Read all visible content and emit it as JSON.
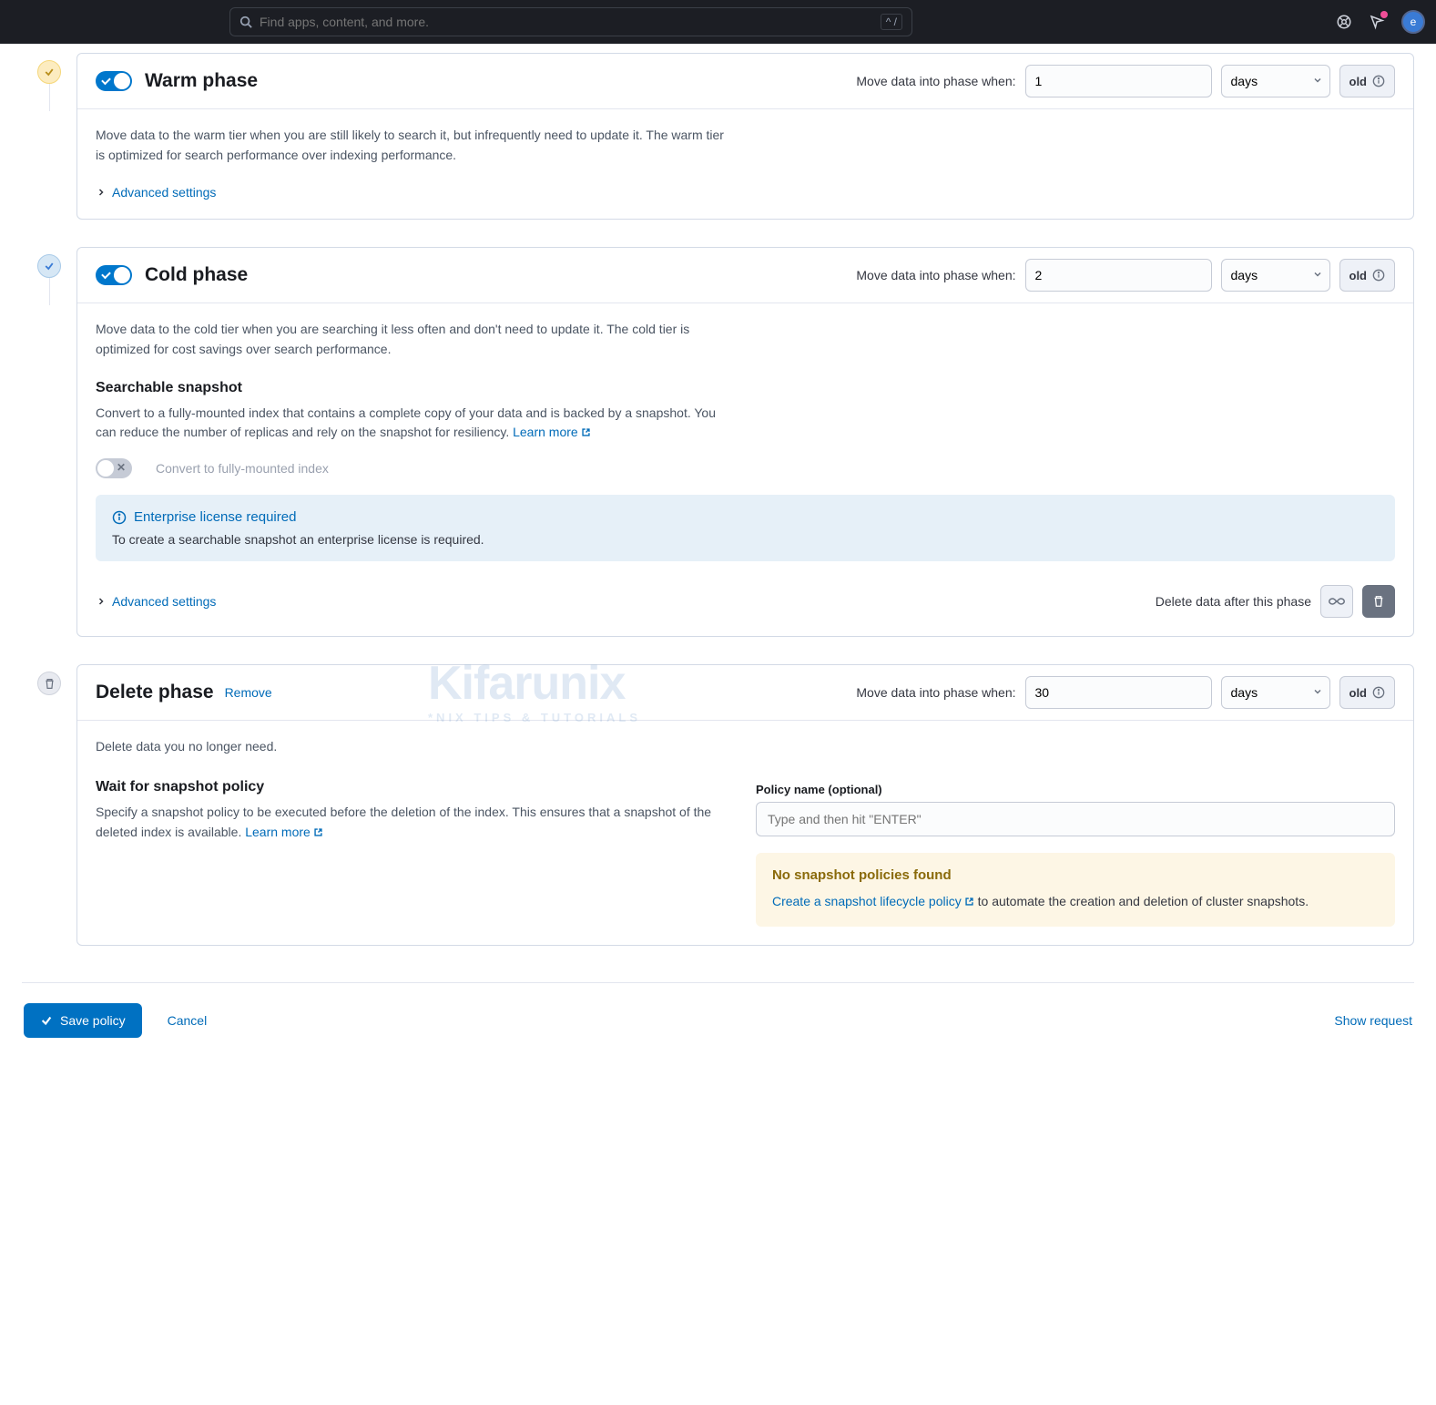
{
  "search": {
    "placeholder": "Find apps, content, and more.",
    "kbd": "^ /"
  },
  "avatar": "e",
  "common": {
    "moveLabel": "Move data into phase when:",
    "unitDays": "days",
    "old": "old",
    "advanced": "Advanced settings",
    "learnMore": "Learn more"
  },
  "warm": {
    "title": "Warm phase",
    "value": "1",
    "desc": "Move data to the warm tier when you are still likely to search it, but infrequently need to update it. The warm tier is optimized for search performance over indexing performance."
  },
  "cold": {
    "title": "Cold phase",
    "value": "2",
    "desc": "Move data to the cold tier when you are searching it less often and don't need to update it. The cold tier is optimized for cost savings over search performance.",
    "snapshotTitle": "Searchable snapshot",
    "snapshotDesc": "Convert to a fully-mounted index that contains a complete copy of your data and is backed by a snapshot. You can reduce the number of replicas and rely on the snapshot for resiliency. ",
    "convertLabel": "Convert to fully-mounted index",
    "licenseTitle": "Enterprise license required",
    "licenseBody": "To create a searchable snapshot an enterprise license is required.",
    "deleteAfter": "Delete data after this phase"
  },
  "delete": {
    "title": "Delete phase",
    "remove": "Remove",
    "value": "30",
    "desc": "Delete data you no longer need.",
    "waitTitle": "Wait for snapshot policy",
    "waitDesc": "Specify a snapshot policy to be executed before the deletion of the index. This ensures that a snapshot of the deleted index is available. ",
    "policyLabel": "Policy name (optional)",
    "policyPlaceholder": "Type and then hit \"ENTER\"",
    "noPolicies": "No snapshot policies found",
    "createPolicy": "Create a snapshot lifecycle policy",
    "createPolicyTail": " to automate the creation and deletion of cluster snapshots."
  },
  "footer": {
    "save": "Save policy",
    "cancel": "Cancel",
    "show": "Show request"
  },
  "watermark": {
    "brand": "Kifarunix",
    "tag": "*NIX TIPS & TUTORIALS"
  }
}
